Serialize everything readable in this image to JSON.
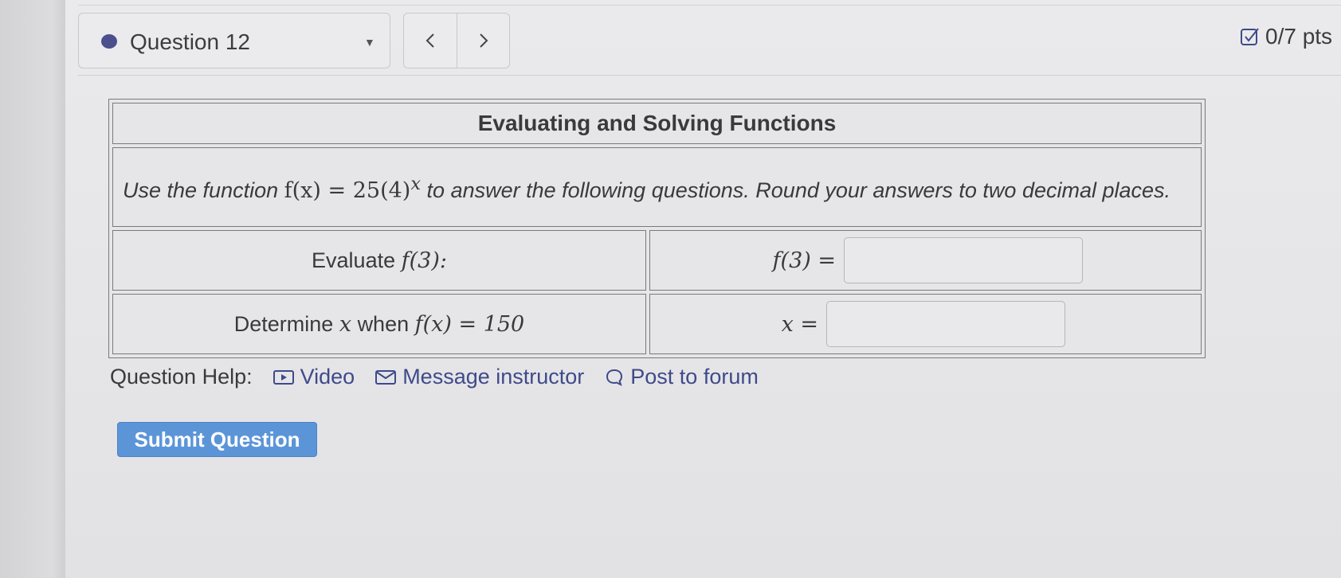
{
  "header": {
    "question_label": "Question 12",
    "points": "0/7 pts"
  },
  "problem": {
    "title": "Evaluating and Solving Functions",
    "instruction_prefix": "Use the function",
    "function_expr": "f(x) = 25(4)",
    "function_exponent": "x",
    "instruction_suffix": "to answer the following questions. Round your answers to two decimal places.",
    "rows": [
      {
        "prompt_text": "Evaluate",
        "prompt_math": "f(3):",
        "answer_label": "f(3) =",
        "answer_value": ""
      },
      {
        "prompt_text_1": "Determine",
        "prompt_var": "x",
        "prompt_text_2": "when",
        "prompt_math": "f(x) = 150",
        "answer_label": "x =",
        "answer_value": ""
      }
    ]
  },
  "help": {
    "label": "Question Help:",
    "video": "Video",
    "message": "Message instructor",
    "forum": "Post to forum"
  },
  "submit_label": "Submit Question"
}
